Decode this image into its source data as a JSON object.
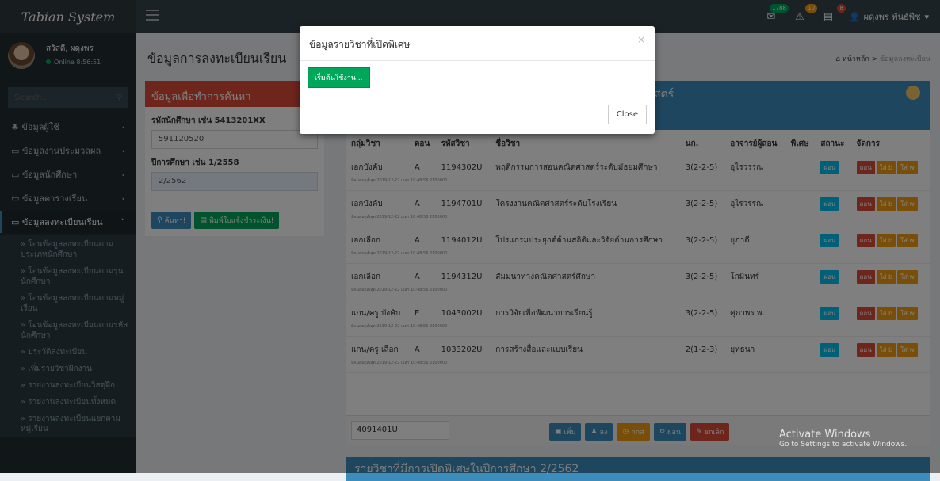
{
  "app": {
    "logo": "Tabian System"
  },
  "topbar": {
    "mail_badge": "1788",
    "alert_badge": "10",
    "task_badge": "8",
    "user": "ผดุงพร พันธ์พืช"
  },
  "sidebar": {
    "greeting": "สวัสดี, ผดุงพร",
    "status": "Online 8:56:51",
    "search_placeholder": "Search...",
    "items": [
      {
        "label": "ข้อมูลผู้ใช้"
      },
      {
        "label": "ข้อมูลงานประมวลผล"
      },
      {
        "label": "ข้อมูลนักศึกษา"
      },
      {
        "label": "ข้อมูลตารางเรียน"
      },
      {
        "label": "ข้อมูลลงทะเบียนเรียน"
      }
    ],
    "subitems": [
      "» โอนข้อมูลลงทะเบียนตามประเภทนักศึกษา",
      "» โอนข้อมูลลงทะเบียนตามรุ่นนักศึกษา",
      "» โอนข้อมูลลงทะเบียนตามหมู่เรียน",
      "» โอนข้อมูลลงทะเบียนตามรหัสนักศึกษา",
      "» ประวัติลงทะเบียน",
      "» เพิ่มรายวิชาฝึกงาน",
      "» รายงานลงทะเบียนวิสดุฝึก",
      "» รายงานลงทะเบียนทั้งหมด",
      "» รายงานลงทะเบียนแยกตามหมู่เรียน"
    ]
  },
  "page": {
    "title": "ข้อมูลการลงทะเบียนเรียน",
    "breadcrumb_home": "หน้าหลัก",
    "breadcrumb_current": "ข้อมูลลงทะเบียน"
  },
  "search_box": {
    "title": "ข้อมูลเพื่อทำการค้นหา",
    "student_label": "รหัสนักศึกษา เช่น 5413201XX",
    "student_value": "591120520",
    "year_label": "ปีการศึกษา เช่น 1/2558",
    "year_value": "2/2562",
    "search_btn": "ค้นหา!",
    "print_btn": "พิมพ์ใบแจ้งชำระเงิน!"
  },
  "result_box": {
    "title_tail": "สตร์",
    "columns": [
      "กลุ่มวิชา",
      "ตอน",
      "รหัสวิชา",
      "ชื่อวิชา",
      "นก.",
      "อาจารย์ผู้สอน",
      "พิเศษ",
      "สถานะ",
      "จัดการ"
    ],
    "rows": [
      {
        "group": "เอกบังคับ",
        "sec": "A",
        "code": "1194302U",
        "name": "พฤติกรรมการสอนคณิตศาสตร์ระดับมัธยมศึกษา",
        "credit": "3(2-2-5)",
        "teacher": "อุไรวรรณ",
        "status": "ผ่อน",
        "note": "มีคนสมดุล์เสุด 2019-12-22 เวลา 10:48:56 2100000"
      },
      {
        "group": "เอกบังคับ",
        "sec": "A",
        "code": "1194701U",
        "name": "โครงงานคณิตศาสตร์ระดับโรงเรียน",
        "credit": "3(2-2-5)",
        "teacher": "อุไรวรรณ",
        "status": "ผ่อน",
        "note": "มีคนสมดุล์เสุด 2019-12-22 เวลา 10:48:56 2100000"
      },
      {
        "group": "เอกเลือก",
        "sec": "A",
        "code": "1194012U",
        "name": "โปรแกรมประยุกต์ด้านสถิติและวิจัยด้านการศึกษา",
        "credit": "3(2-2-5)",
        "teacher": "ยุภาดี",
        "status": "ผ่อน",
        "note": "มีคนสมดุล์เสุด 2019-12-22 เวลา 10:48:56 2100000"
      },
      {
        "group": "เอกเลือก",
        "sec": "A",
        "code": "1194312U",
        "name": "สัมมนาทางคณิตศาสตร์ศึกษา",
        "credit": "3(2-2-5)",
        "teacher": "โกมินทร์",
        "status": "ผ่อน",
        "note": "มีคนสมดุล์เสุด 2019-12-22 เวลา 10:48:56 2100000"
      },
      {
        "group": "แกน/ครู บังคับ",
        "sec": "E",
        "code": "1043002U",
        "name": "การวิจัยเพื่อพัฒนาการเรียนรู้",
        "credit": "3(2-2-5)",
        "teacher": "ศุภาพร พ.",
        "status": "ผ่อน",
        "note": "มีคนสมดุล์เสุด 2019-12-22 เวลา 10:48:56 2100000"
      },
      {
        "group": "แกน/ครู เลือก",
        "sec": "A",
        "code": "1033202U",
        "name": "การสร้างสื่อและแบบเรียน",
        "credit": "2(1-2-3)",
        "teacher": "ยุทธนา",
        "status": "ผ่อน",
        "note": "มีคนสมดุล์เสุด 2019-12-22 เวลา 10:48:56 2100000"
      }
    ],
    "row_actions": [
      "ถอน",
      "ใส่ b",
      "ใส่ w"
    ],
    "bottom_code": "4091401U",
    "bottom_btns": [
      "เพิ่ม",
      "ลง",
      "กกส",
      "ผ่อน",
      "ยกเลิก"
    ]
  },
  "lower_box": {
    "title": "รายวิชาที่มีการเปิดพิเศษในปีการศึกษา 2/2562"
  },
  "watermark": {
    "line1": "Activate Windows",
    "line2": "Go to Settings to activate Windows."
  },
  "modal": {
    "title": "ข้อมูลรายวิชาที่เปิดพิเศษ",
    "close_x": "×",
    "start_btn": "เริ่มต้นใช้งาน...",
    "close_btn": "Close"
  }
}
